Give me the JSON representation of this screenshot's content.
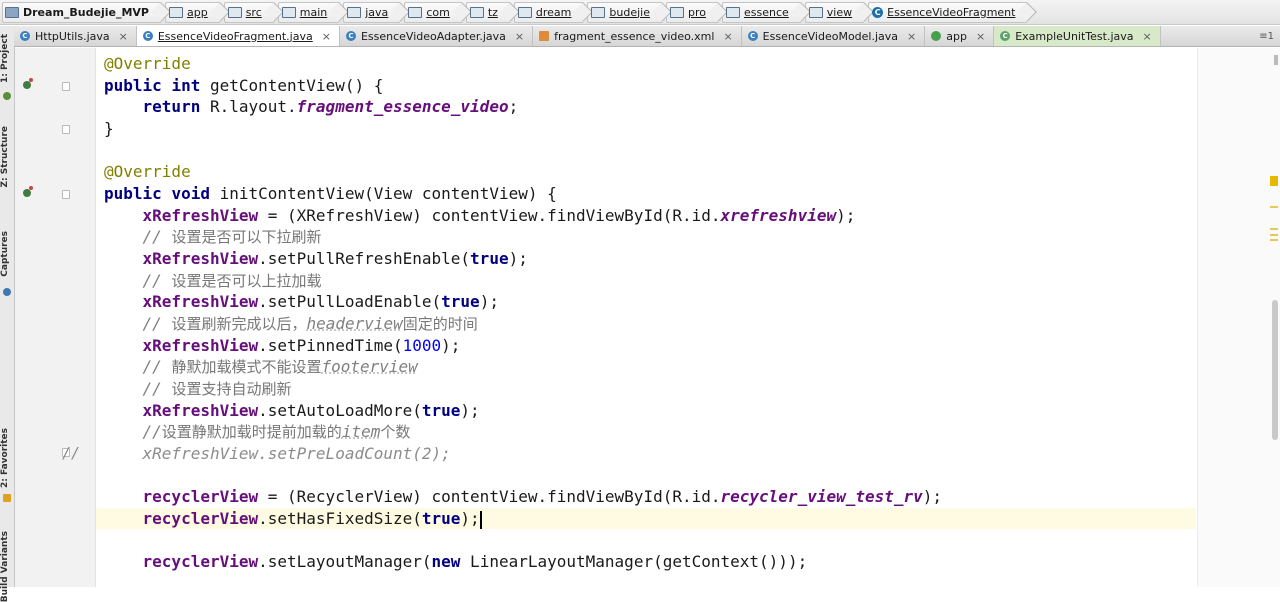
{
  "breadcrumbs": [
    {
      "label": "Dream_Budejie_MVP",
      "kind": "project"
    },
    {
      "label": "app",
      "kind": "module"
    },
    {
      "label": "src",
      "kind": "folder"
    },
    {
      "label": "main",
      "kind": "folder"
    },
    {
      "label": "java",
      "kind": "folder"
    },
    {
      "label": "com",
      "kind": "package"
    },
    {
      "label": "tz",
      "kind": "package"
    },
    {
      "label": "dream",
      "kind": "package"
    },
    {
      "label": "budejie",
      "kind": "package"
    },
    {
      "label": "pro",
      "kind": "package"
    },
    {
      "label": "essence",
      "kind": "package"
    },
    {
      "label": "view",
      "kind": "package"
    },
    {
      "label": "EssenceVideoFragment",
      "kind": "class"
    }
  ],
  "tabs": [
    {
      "label": "HttpUtils.java",
      "active": false,
      "close": "×",
      "icon": "class-icon"
    },
    {
      "label": "EssenceVideoFragment.java",
      "active": true,
      "close": "×",
      "icon": "class-icon"
    },
    {
      "label": "EssenceVideoAdapter.java",
      "active": false,
      "close": "×",
      "icon": "class-icon"
    },
    {
      "label": "fragment_essence_video.xml",
      "active": false,
      "close": "×",
      "icon": "xml-file-icon"
    },
    {
      "label": "EssenceVideoModel.java",
      "active": false,
      "close": "×",
      "icon": "class-icon"
    },
    {
      "label": "app",
      "active": false,
      "close": "×",
      "icon": "android-module-icon"
    },
    {
      "label": "ExampleUnitTest.java",
      "active": false,
      "close": "×",
      "icon": "test-class-icon"
    }
  ],
  "tab_overflow_label": "≡1",
  "tool_windows": {
    "project": "1: Project",
    "structure": "Z: Structure",
    "captures": "Captures",
    "favorites": "2: Favorites",
    "build_variants": "Build Variants"
  },
  "code": {
    "line1_annotation": "@Override",
    "line2": {
      "kw1": "public",
      "kw2": "int",
      "rest": " getContentView() {"
    },
    "line3": {
      "kw": "return",
      "pre": " R.layout.",
      "res": "fragment_essence_video",
      "post": ";"
    },
    "line4": "}",
    "line6_annotation": "@Override",
    "line7": {
      "kw1": "public",
      "kw2": "void",
      "rest": " initContentView(View contentView) {"
    },
    "line8": {
      "field": "xRefreshView",
      "mid": " = (XRefreshView) contentView.findViewById(R.id.",
      "res": "xrefreshview",
      "post": ");"
    },
    "line9": {
      "slashes": "// ",
      "text": "设置是否可以下拉刷新"
    },
    "line10": {
      "field": "xRefreshView",
      "call": ".setPullRefreshEnable(",
      "kw": "true",
      "post": ");"
    },
    "line11": {
      "slashes": "// ",
      "text": "设置是否可以上拉加载"
    },
    "line12": {
      "field": "xRefreshView",
      "call": ".setPullLoadEnable(",
      "kw": "true",
      "post": ");"
    },
    "line13": {
      "slashes": "// ",
      "text": "设置刷新完成以后，",
      "tag": "headerview",
      "tail": "固定的时间"
    },
    "line14": {
      "field": "xRefreshView",
      "call": ".setPinnedTime(",
      "num": "1000",
      "post": ");"
    },
    "line15": {
      "slashes": "// ",
      "text": "静默加载模式不能设置",
      "tag": "footerview"
    },
    "line16": {
      "slashes": "// ",
      "text": "设置支持自动刷新"
    },
    "line17": {
      "field": "xRefreshView",
      "call": ".setAutoLoadMore(",
      "kw": "true",
      "post": ");"
    },
    "line18": {
      "slashes": "//",
      "text": "设置静默加载时提前加载的",
      "tag": "item",
      "tail": "个数"
    },
    "line19_gutter": "//",
    "line19": "xRefreshView.setPreLoadCount(2);",
    "line21": {
      "field": "recyclerView",
      "mid": " = (RecyclerView) contentView.findViewById(R.id.",
      "res": "recycler_view_test_rv",
      "post": ");"
    },
    "line22": {
      "field": "recyclerView",
      "call": ".setHasFixedSize(",
      "kw": "true",
      "post": ");"
    },
    "line24": {
      "field": "recyclerView",
      "call": ".setLayoutManager(",
      "kw": "new",
      "post": " LinearLayoutManager(getContext()));"
    }
  },
  "colors": {
    "keyword": "#000080",
    "annotation": "#808000",
    "field": "#660e7a",
    "number": "#0000ff",
    "comment": "#808080",
    "current_line": "#fffbe3"
  }
}
